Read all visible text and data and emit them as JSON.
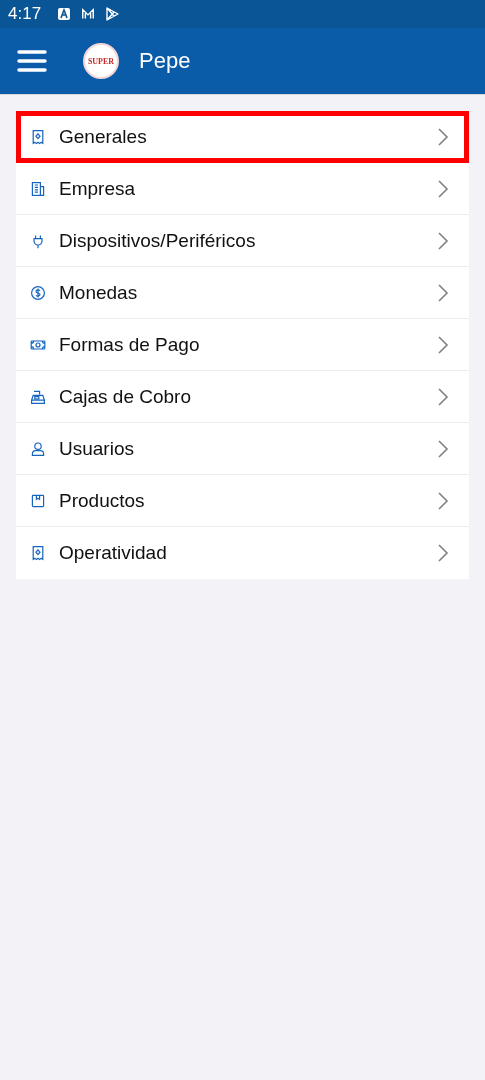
{
  "status_bar": {
    "time": "4:17"
  },
  "app_bar": {
    "logo_text": "SUPER",
    "title": "Pepe"
  },
  "menu": [
    {
      "label": "Generales",
      "kind": "receipt",
      "selected": true
    },
    {
      "label": "Empresa",
      "kind": "building",
      "selected": false
    },
    {
      "label": "Dispositivos/Periféricos",
      "kind": "plug",
      "selected": false
    },
    {
      "label": "Monedas",
      "kind": "coin",
      "selected": false
    },
    {
      "label": "Formas de Pago",
      "kind": "cash",
      "selected": false
    },
    {
      "label": "Cajas de Cobro",
      "kind": "register",
      "selected": false
    },
    {
      "label": "Usuarios",
      "kind": "user",
      "selected": false
    },
    {
      "label": "Productos",
      "kind": "box",
      "selected": false
    },
    {
      "label": "Operatividad",
      "kind": "receipt",
      "selected": false
    }
  ]
}
